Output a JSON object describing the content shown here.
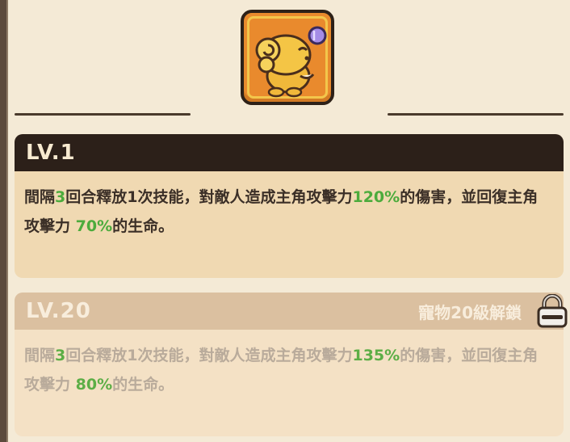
{
  "levels": [
    {
      "level_label": "LV.1",
      "description": {
        "p1": "間隔",
        "interval": "3",
        "p2": "回合釋放1次技能，對敵人造成主角攻擊力",
        "damage_pct": "120%",
        "p3": "的傷害，並回復主角攻擊力 ",
        "heal_pct": "70%",
        "p4": "的生命。"
      },
      "locked": false
    },
    {
      "level_label": "LV.20",
      "unlock_text": "寵物20級解鎖",
      "description": {
        "p1": "間隔",
        "interval": "3",
        "p2": "回合釋放1次技能，對敵人造成主角攻擊力",
        "damage_pct": "135%",
        "p3": "的傷害，並回復主角攻擊力 ",
        "heal_pct": "80%",
        "p4": "的生命。"
      },
      "locked": true
    }
  ],
  "icons": [
    "pet-portrait-icon",
    "padlock-icon"
  ]
}
